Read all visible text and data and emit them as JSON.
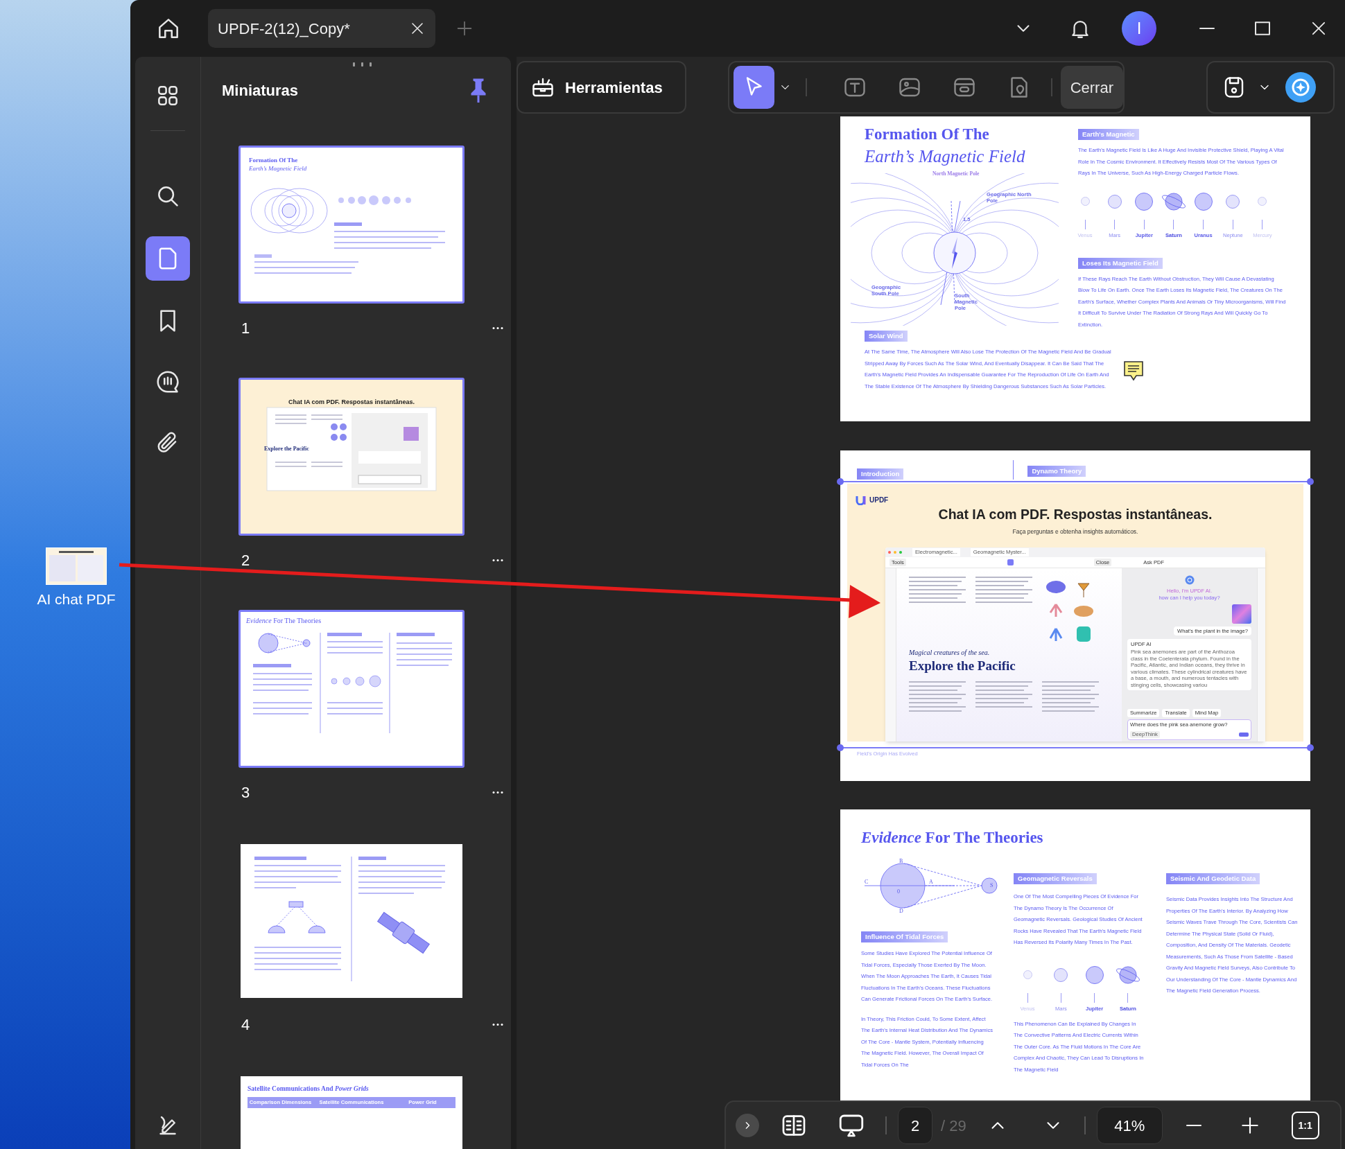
{
  "desktop": {
    "icon_label": "AI chat PDF"
  },
  "window": {
    "tab_title": "UPDF-2(12)_Copy*",
    "avatar_initial": "I"
  },
  "rail": {
    "items": [
      {
        "kind": "apps",
        "selected": false
      },
      {
        "kind": "search",
        "selected": false
      },
      {
        "kind": "pages",
        "selected": true
      },
      {
        "kind": "bookmark",
        "selected": false
      },
      {
        "kind": "comment",
        "selected": false
      },
      {
        "kind": "attachment",
        "selected": false
      }
    ]
  },
  "panel": {
    "title": "Miniaturas"
  },
  "thumbnails": [
    {
      "kind": "magnetic",
      "number": "1",
      "selected": true,
      "titles": [
        "Formation Of The",
        "*Earth’s Magnetic Field*"
      ]
    },
    {
      "kind": "chat",
      "number": "2",
      "selected": true,
      "titles": [
        "Chat IA com PDF. Respostas instantâneas.",
        "Explore the Pacific"
      ]
    },
    {
      "kind": "evidence",
      "number": "3",
      "selected": true,
      "titles": [
        "*Evidence* For The Theories"
      ]
    },
    {
      "kind": "satellite",
      "number": "4",
      "selected": false
    },
    {
      "kind": "table",
      "selected": false,
      "titles": [
        "Satellite Communications And *Power Grids*",
        "Comparison Dimensions",
        "Satellite Communications",
        "Power Grid"
      ]
    }
  ],
  "toolbar": {
    "tools_label": "Herramientas",
    "close_label": "Cerrar",
    "tools": [
      {
        "kind": "select",
        "selected": true
      },
      {
        "kind": "text",
        "selected": false
      },
      {
        "kind": "image",
        "selected": false
      },
      {
        "kind": "link",
        "selected": false
      },
      {
        "kind": "location",
        "selected": false
      }
    ]
  },
  "page_1": {
    "title_line_1": "Formation Of The",
    "title_line_2": "Earth’s Magnetic Field",
    "diagram_labels": [
      "North Magnetic Pole",
      "Geographic North Pole",
      "1.5",
      "Geographic South Pole",
      "South Magnetic Pole"
    ],
    "sections": [
      {
        "heading": "Earth's Magnetic",
        "body": "The Earth's Magnetic Field Is Like A Huge And Invisible Protective Shield, Playing A Vital Role In The Cosmic Environment. It Effectively Resists Most Of The Various Types Of Rays In The Universe, Such As High-Energy Charged Particle Flows."
      },
      {
        "heading": "Loses Its Magnetic Field",
        "body": "If These Rays Reach The Earth Without Obstruction, They Will Cause A Devastating Blow To Life On Earth. Once The Earth Loses Its Magnetic Field, The Creatures On The Earth's Surface, Whether Complex Plants And Animals Or Tiny Microorganisms, Will Find It Difficult To Survive Under The Radiation Of Strong Rays And Will Quickly Go To Extinction."
      },
      {
        "heading": "Solar Wind",
        "body": "At The Same Time, The Atmosphere Will Also Lose The Protection Of The Magnetic Field And Be Gradual Stripped Away By Forces Such As The Solar Wind, And Eventually Disappear. It Can Be Said That The Earth's Magnetic Field Provides An Indispensable Guarantee For The Reproduction Of Life On Earth And The Stable Existence Of The Atmosphere By Shielding Dangerous Substances Such As Solar Particles."
      }
    ],
    "planets": [
      {
        "label": "Venus",
        "kind": "faint"
      },
      {
        "label": "Mars",
        "kind": "medium"
      },
      {
        "label": "Jupiter",
        "kind": "large"
      },
      {
        "label": "Saturn",
        "kind": "ringed"
      },
      {
        "label": "Uranus",
        "kind": "large"
      },
      {
        "label": "Neptune",
        "kind": "medium"
      },
      {
        "label": "Mercury",
        "kind": "faint"
      }
    ]
  },
  "page_2": {
    "tags": [
      "Introduction",
      "Dynamo Theory"
    ],
    "footer": "Field's Origin Has Evolved",
    "banner": {
      "logo": "UPDF",
      "heading": "Chat IA com PDF. Respostas instantâneas.",
      "subheading": "Faça perguntas e obtenha insights automáticos."
    },
    "app_screenshot": {
      "tabs": [
        "Electromagnetic...",
        "Geomagnetic Myster..."
      ],
      "tools_label": "Tools",
      "close_label": "Close",
      "panel_title": "Ask PDF",
      "subtitle": "Magical creatures of the sea.",
      "title": "Explore the Pacific",
      "greeting": "Hello, I'm UPDF AI.",
      "greeting_2": "how can I help you today?",
      "question": "What's the plant in the image?",
      "answer_title": "UPDF AI",
      "answer": "Pink sea anemones are part of the Anthozoa class in the Coelenterata phylum. Found in the Pacific, Atlantic, and Indian oceans, they thrive in various climates. These cylindrical creatures have a base, a mouth, and numerous tentacles with stinging cells, showcasing variou",
      "actions": [
        "Summarize",
        "Translate",
        "Mind Map"
      ],
      "input": "Where does the pink sea anemone grow?",
      "mode": "DeepThink"
    }
  },
  "page_3": {
    "title": "*Evidence* For The Theories",
    "diagram_labels": [
      "B",
      "C",
      "0",
      "A",
      "D",
      "S"
    ],
    "columns": [
      {
        "heading": "Influence Of Tidal Forces",
        "paragraphs": [
          "Some Studies Have Explored The Potential Influence Of Tidal Forces, Especially Those Exerted By The Moon. When The Moon Approaches The Earth, It Causes Tidal Fluctuations In The Earth's Oceans. These Fluctuations Can Generate Frictional Forces On The Earth's Surface.",
          "In Theory, This Friction Could, To Some Extent, Affect The Earth's Internal Heat Distribution And The Dynamics Of The Core - Mantle System, Potentially Influencing The Magnetic Field. However, The Overall Impact Of Tidal Forces On The"
        ]
      },
      {
        "heading": "Geomagnetic Reversals",
        "paragraphs": [
          "One Of The Most Compelling Pieces Of Evidence For The Dynamo Theory Is The Occurrence Of Geomagnetic Reversals. Geological Studies Of Ancient Rocks Have Revealed That The Earth's Magnetic Field Has Reversed Its Polarity Many Times In The Past.",
          "This Phenomenon Can Be Explained By Changes In The Convective Patterns And Electric Currents Within The Outer Core. As The Fluid Motions In The Core Are Complex And Chaotic, They Can Lead To Disruptions In The Magnetic Field"
        ]
      },
      {
        "heading": "Seismic And Geodetic Data",
        "paragraphs": [
          "Seismic Data Provides Insights Into The Structure And Properties Of The Earth's Interior. By Analyzing How Seismic Waves Trave Through The Core, Scientists Can Determine The Physical State (Solid Or Fluid), Composition, And Density Of The Materials. Geodetic Measurements, Such As Those From Satellite - Based Gravity And Magnetic Field Surveys, Also Contribute To Our Understanding Of The Core - Mantle Dynamics And The Magnetic Field Generation Process."
        ]
      }
    ],
    "planets": [
      {
        "label": "Venus",
        "kind": "faint"
      },
      {
        "label": "Mars",
        "kind": "medium"
      },
      {
        "label": "Jupiter",
        "kind": "large"
      },
      {
        "label": "Saturn",
        "kind": "ringed"
      }
    ]
  },
  "bottom_bar": {
    "page": "2",
    "total": "/ 29",
    "zoom": "41%",
    "actual_size": "1:1"
  }
}
